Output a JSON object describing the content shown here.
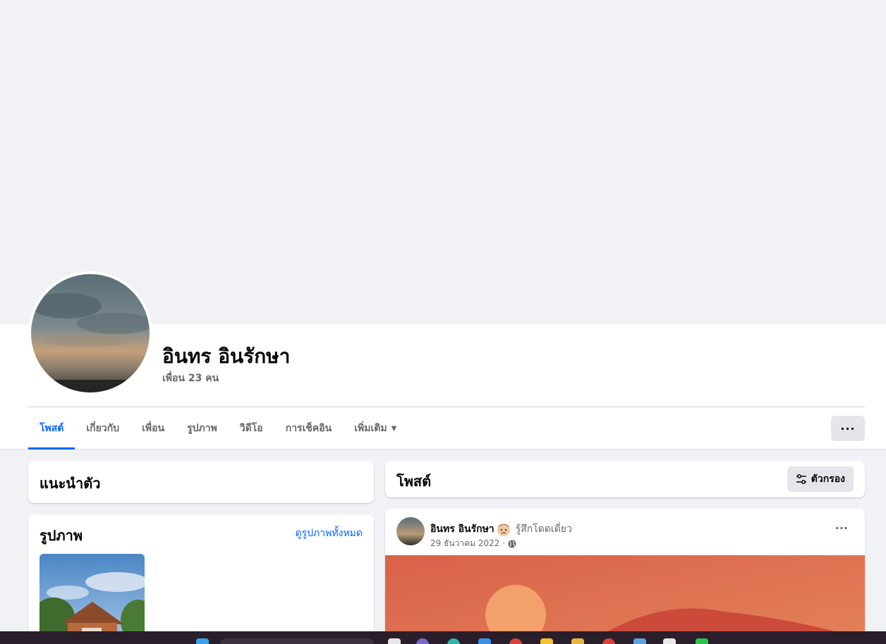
{
  "profile": {
    "name": "อินทร อินรักษา",
    "friends": "เพื่อน 23 คน"
  },
  "tabs": [
    {
      "label": "โพสต์",
      "active": true
    },
    {
      "label": "เกี่ยวกับ"
    },
    {
      "label": "เพื่อน"
    },
    {
      "label": "รูปภาพ"
    },
    {
      "label": "วิดีโอ"
    },
    {
      "label": "การเช็คอิน"
    },
    {
      "label": "เพิ่มเติม"
    }
  ],
  "more_button": "···",
  "intro": {
    "title": "แนะนำตัว"
  },
  "photos": {
    "title": "รูปภาพ",
    "see_all": "ดูรูปภาพทั้งหมด"
  },
  "posts": {
    "title": "โพสต์",
    "filter_label": "ตัวกรอง"
  },
  "post": {
    "author": "อินทร อินรักษา",
    "feeling": "รู้สึกโดดเดี่ยว",
    "date": "29 ธันวาคม 2022 ·",
    "menu": "···"
  },
  "colors": {
    "accent": "#0866ff",
    "page_bg": "#f0f2f5",
    "post_image_bg": "#e0704e"
  }
}
